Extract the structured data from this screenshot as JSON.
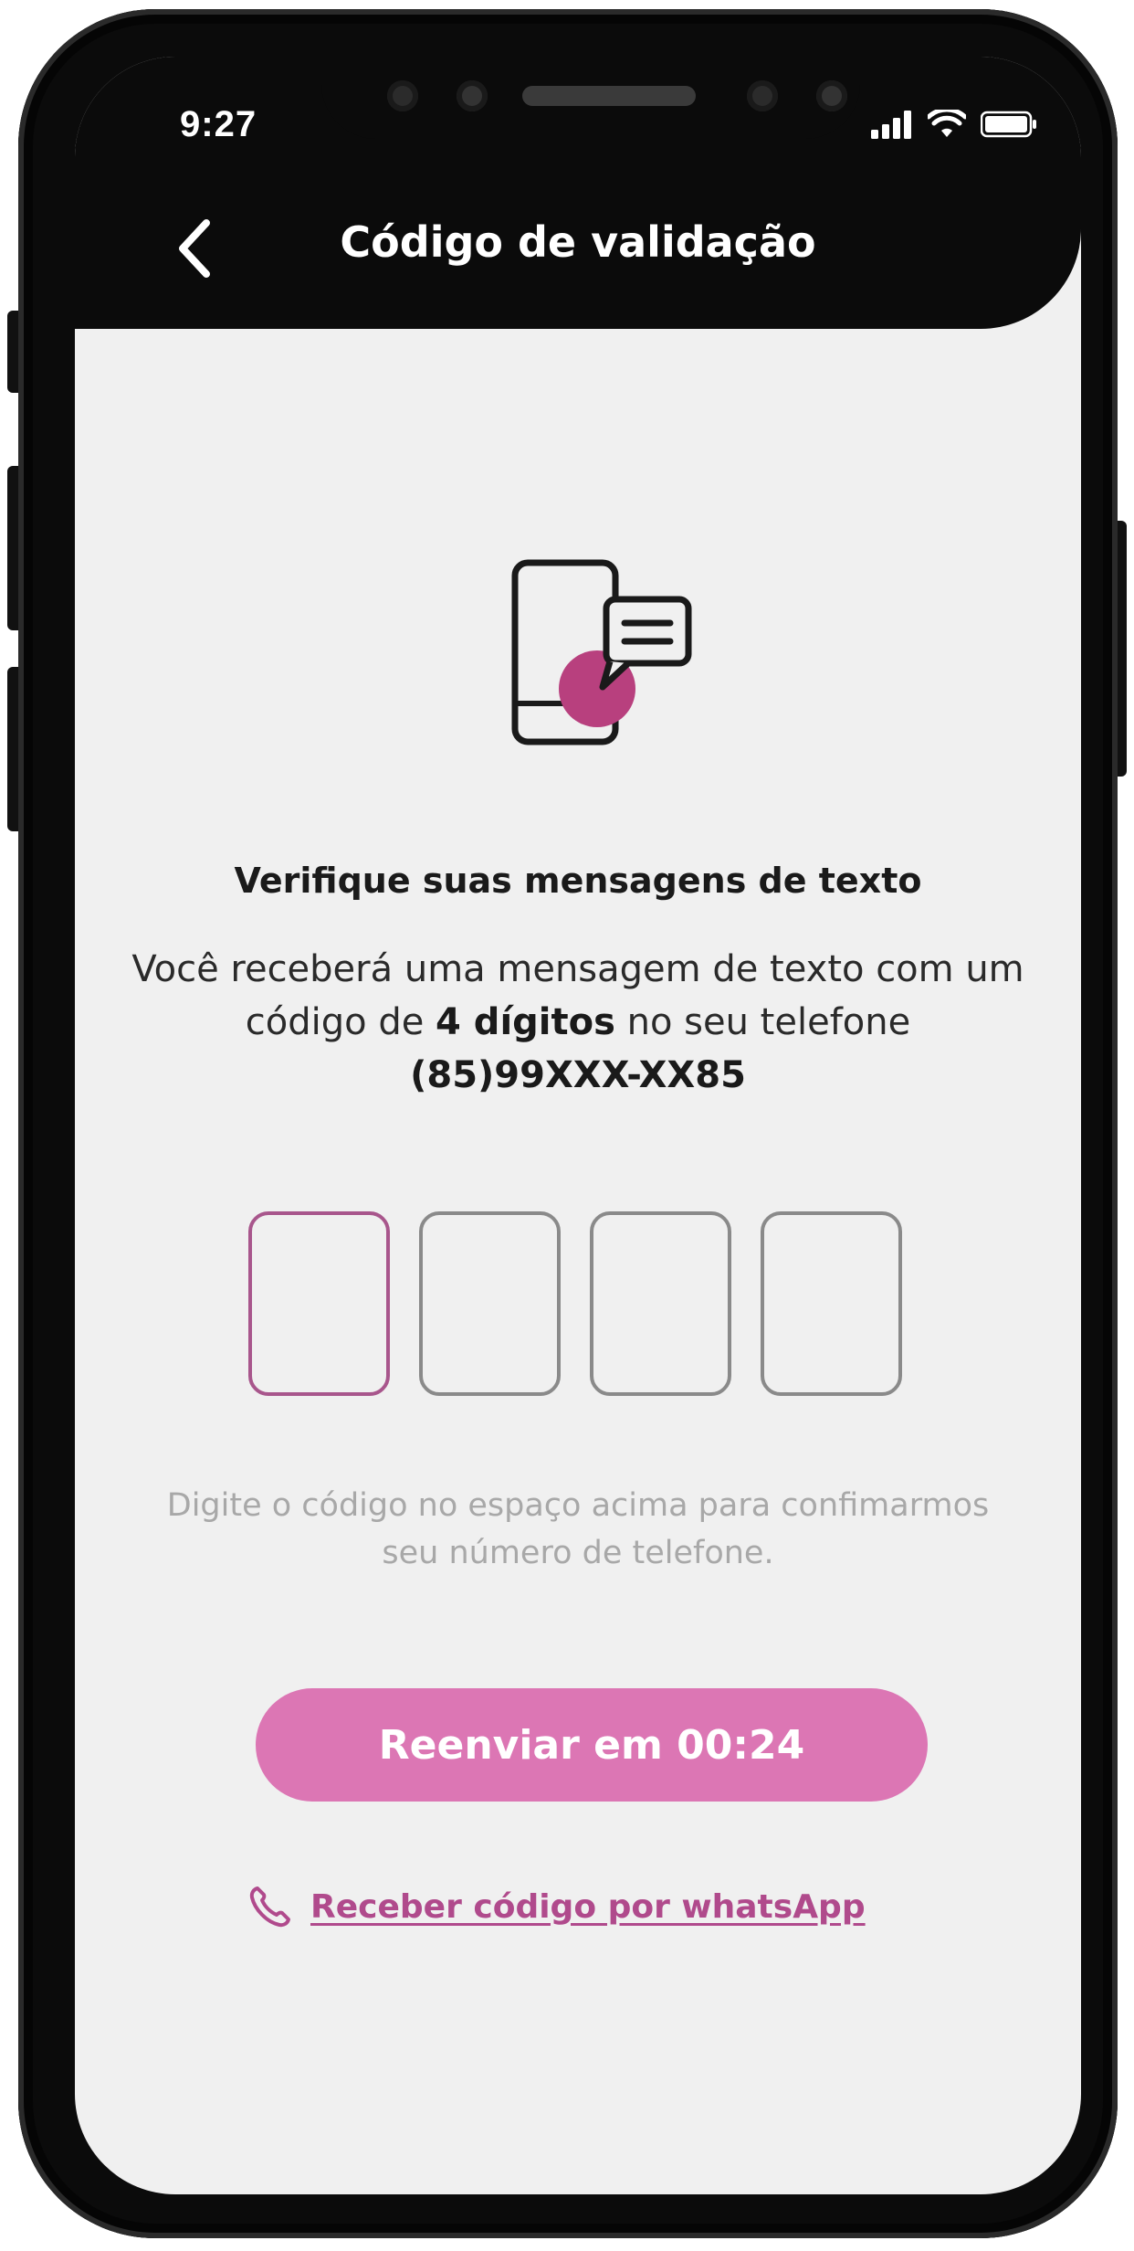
{
  "status_bar": {
    "time": "9:27",
    "icons": [
      "signal-icon",
      "wifi-icon",
      "battery-icon"
    ]
  },
  "header": {
    "title": "Código de validação",
    "back_icon": "chevron-left-icon"
  },
  "hero": {
    "icon": "phone-message-icon"
  },
  "content": {
    "headline": "Verifique suas mensagens de texto",
    "desc_part1": "Você receberá uma mensagem de texto com um código de ",
    "desc_bold1": "4 dígitos",
    "desc_part2": " no seu telefone ",
    "desc_bold2": "(85)99XXX-XX85",
    "hint": "Digite o código no espaço acima para confimarmos seu número de telefone."
  },
  "code_input": {
    "digits": [
      "",
      "",
      "",
      ""
    ]
  },
  "actions": {
    "resend_label": "Reenviar em 00:24",
    "whatsapp_label": "Receber código por whatsApp"
  },
  "colors": {
    "accent": "#dc76b4",
    "link": "#b04a8c",
    "active_border": "#a8568c",
    "header_bg": "#0b0b0b",
    "screen_bg": "#f0f0f0"
  }
}
